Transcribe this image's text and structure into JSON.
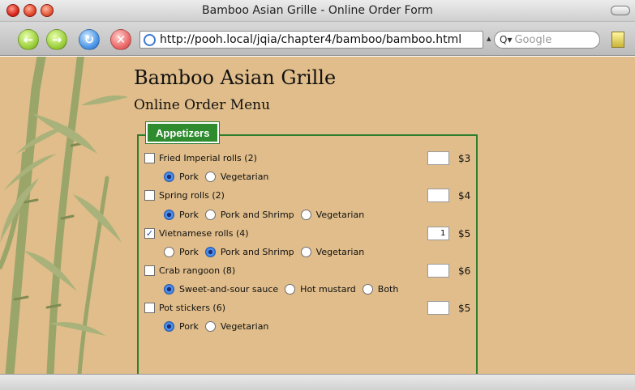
{
  "window": {
    "title": "Bamboo Asian Grille - Online Order Form"
  },
  "toolbar": {
    "url": "http://pooh.local/jqia/chapter4/bamboo/bamboo.html",
    "search_placeholder": "Google"
  },
  "page": {
    "heading": "Bamboo Asian Grille",
    "subheading": "Online Order Menu",
    "legend": "Appetizers",
    "items": [
      {
        "name": "Fried Imperial rolls (2)",
        "checked": false,
        "qty": "",
        "price": "$3",
        "options": [
          {
            "label": "Pork",
            "selected": true
          },
          {
            "label": "Vegetarian",
            "selected": false
          }
        ]
      },
      {
        "name": "Spring rolls (2)",
        "checked": false,
        "qty": "",
        "price": "$4",
        "options": [
          {
            "label": "Pork",
            "selected": true
          },
          {
            "label": "Pork and Shrimp",
            "selected": false
          },
          {
            "label": "Vegetarian",
            "selected": false
          }
        ]
      },
      {
        "name": "Vietnamese rolls (4)",
        "checked": true,
        "qty": "1",
        "price": "$5",
        "options": [
          {
            "label": "Pork",
            "selected": false
          },
          {
            "label": "Pork and Shrimp",
            "selected": true
          },
          {
            "label": "Vegetarian",
            "selected": false
          }
        ]
      },
      {
        "name": "Crab rangoon (8)",
        "checked": false,
        "qty": "",
        "price": "$6",
        "options": [
          {
            "label": "Sweet-and-sour sauce",
            "selected": true
          },
          {
            "label": "Hot mustard",
            "selected": false
          },
          {
            "label": "Both",
            "selected": false
          }
        ]
      },
      {
        "name": "Pot stickers (6)",
        "checked": false,
        "qty": "",
        "price": "$5",
        "options": [
          {
            "label": "Pork",
            "selected": true
          },
          {
            "label": "Vegetarian",
            "selected": false
          }
        ]
      }
    ]
  },
  "colors": {
    "page_background": "#e0bd8a",
    "legend_green": "#2e8b2e",
    "bamboo": "#9aa56a"
  }
}
